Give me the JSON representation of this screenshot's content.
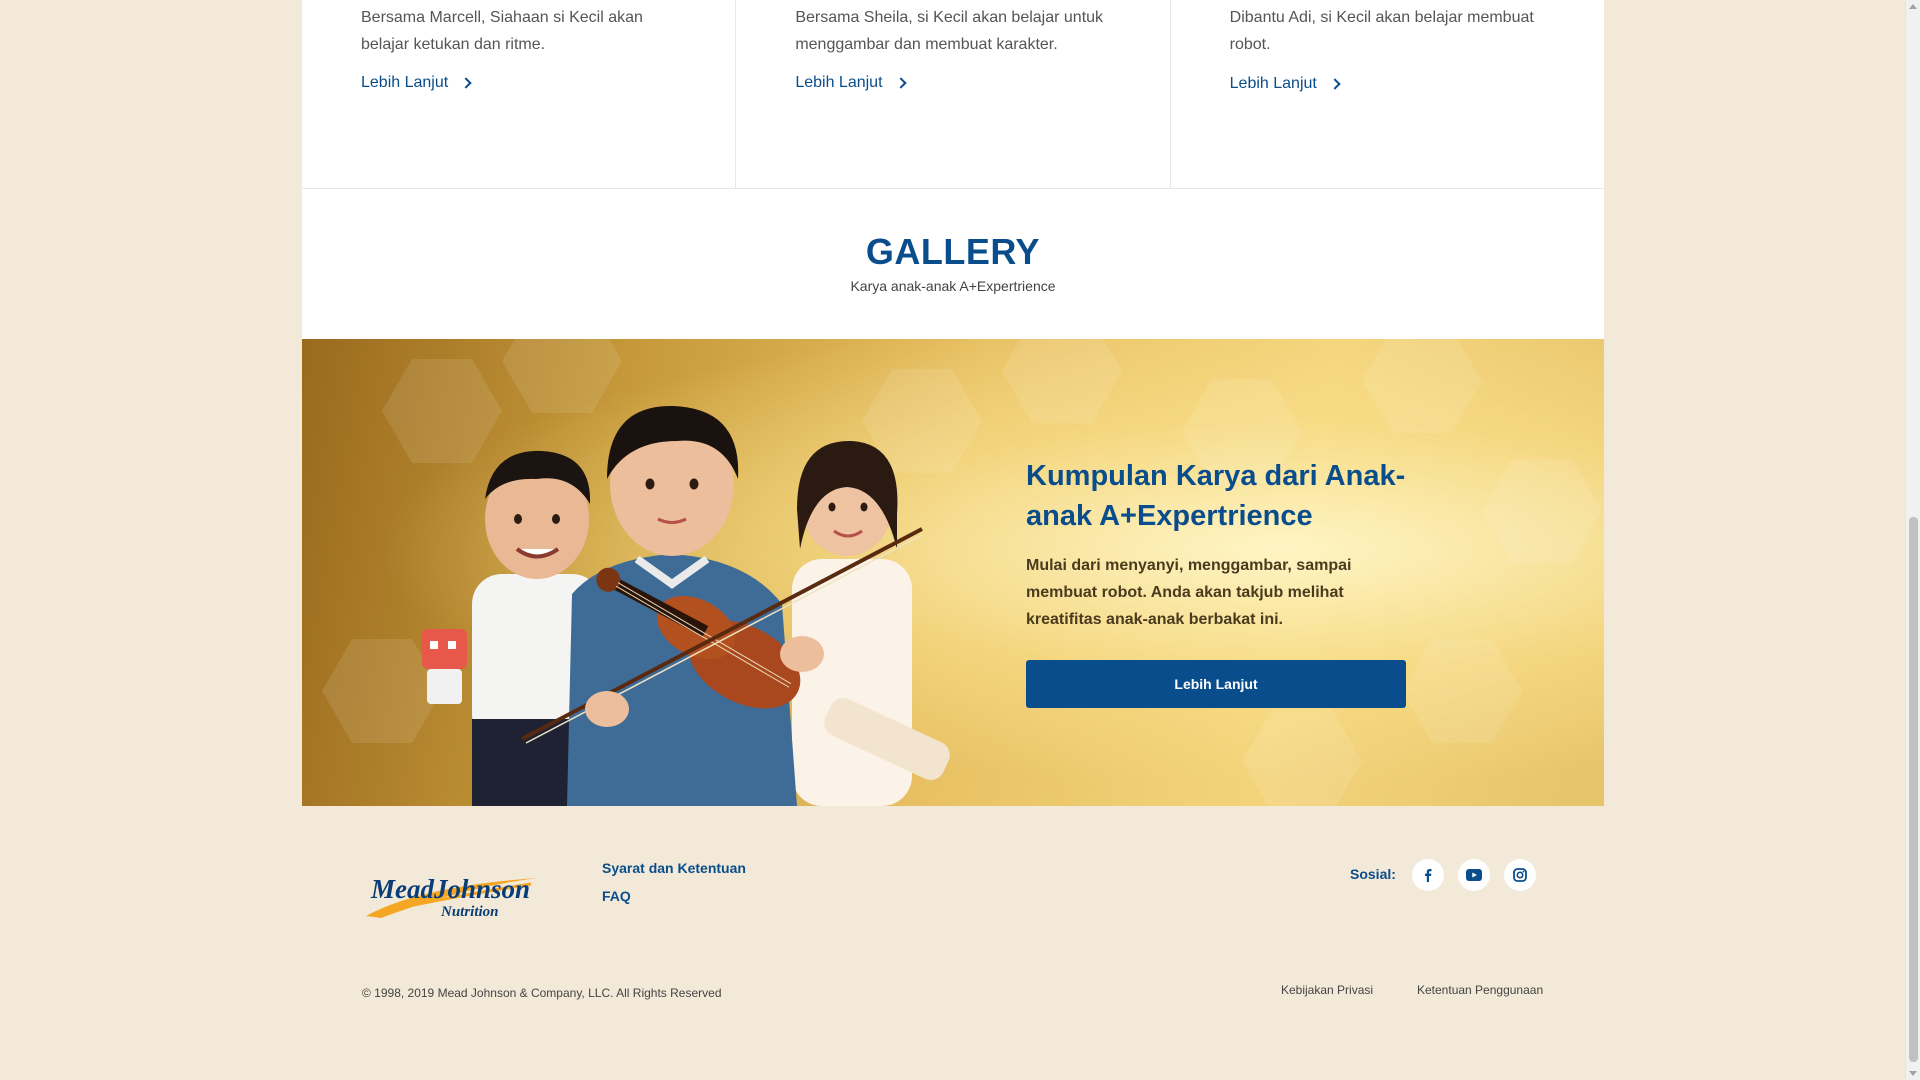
{
  "cards": [
    {
      "description": "Bersama Marcell, Siahaan si Kecil akan belajar ketukan dan ritme.",
      "link": "Lebih Lanjut"
    },
    {
      "description": "Bersama Sheila, si Kecil akan belajar untuk menggambar dan membuat karakter.",
      "link": "Lebih Lanjut"
    },
    {
      "description": "Dibantu Adi, si Kecil akan belajar membuat robot.",
      "link": "Lebih Lanjut"
    }
  ],
  "gallery": {
    "title": "GALLERY",
    "subtitle": "Karya anak-anak A+Expertrience"
  },
  "banner": {
    "title": "Kumpulan Karya dari Anak-anak A+Expertrience",
    "text": "Mulai dari menyanyi, menggambar, sampai membuat robot. Anda akan takjub melihat kreatifitas anak-anak berbakat ini.",
    "button": "Lebih Lanjut"
  },
  "footer": {
    "logo_text": "MeadJohnson",
    "logo_subtext": "Nutrition",
    "links": [
      "Syarat dan Ketentuan",
      "FAQ"
    ],
    "social_label": "Sosial:",
    "social_icons": [
      "facebook-icon",
      "youtube-icon",
      "instagram-icon"
    ],
    "copyright": "© 1998, 2019 Mead Johnson & Company, LLC. All Rights Reserved",
    "legal_links": [
      "Kebijakan Privasi",
      "Ketentuan Penggunaan"
    ]
  },
  "colors": {
    "primary": "#0a4d8c",
    "background": "#f2e9d8",
    "logo_orange": "#f5a623"
  }
}
